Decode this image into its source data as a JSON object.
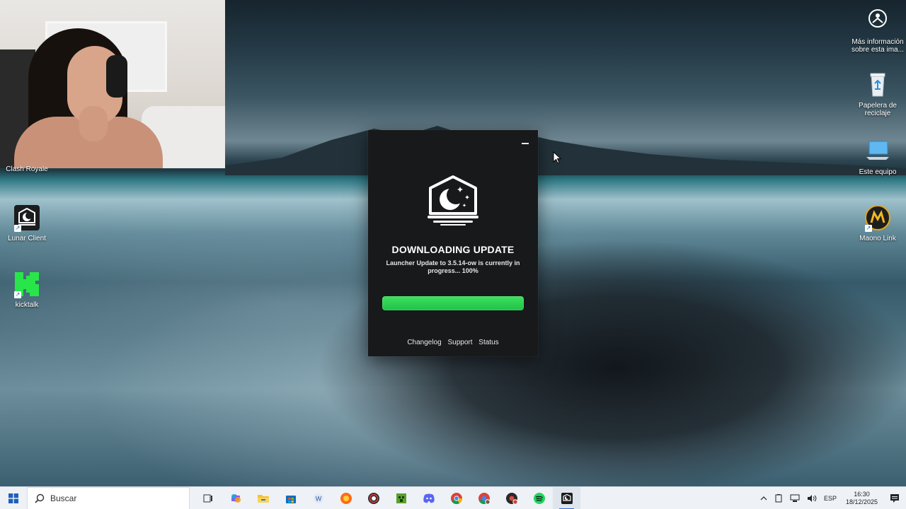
{
  "desktop": {
    "icons_left": [
      {
        "label": "Clash Royale",
        "icon": "clash-royale-icon"
      },
      {
        "label": "Lunar Client",
        "icon": "lunar-client-icon"
      },
      {
        "label": "kicktalk",
        "icon": "kicktalk-icon"
      }
    ],
    "icons_right": [
      {
        "label": "Más información sobre esta ima...",
        "icon": "info-camera-icon"
      },
      {
        "label": "Papelera de reciclaje",
        "icon": "recycle-bin-icon"
      },
      {
        "label": "Este equipo",
        "icon": "this-pc-icon"
      },
      {
        "label": "Maono Link",
        "icon": "maono-link-icon"
      }
    ]
  },
  "launcher": {
    "title": "DOWNLOADING UPDATE",
    "subtitle": "Launcher Update to 3.5.14-ow is currently in progress... 100%",
    "progress": 1.0,
    "links": [
      "Changelog",
      "Support",
      "Status"
    ],
    "accent": "#22c84c",
    "logo_icon": "lunar-moon-house-icon",
    "minimize_icon": "minimize-icon"
  },
  "taskbar": {
    "search_placeholder": "Buscar",
    "apps": [
      {
        "name": "task-view-icon"
      },
      {
        "name": "copilot-icon"
      },
      {
        "name": "file-explorer-icon"
      },
      {
        "name": "microsoft-store-icon"
      },
      {
        "name": "word-icon"
      },
      {
        "name": "brave-icon"
      },
      {
        "name": "obs-icon"
      },
      {
        "name": "minecraft-icon"
      },
      {
        "name": "discord-icon"
      },
      {
        "name": "chrome-icon"
      },
      {
        "name": "chrome-profile-icon"
      },
      {
        "name": "chrome-profile-2-icon"
      },
      {
        "name": "spotify-icon"
      },
      {
        "name": "lunar-client-icon",
        "active": true
      }
    ],
    "tray": {
      "language": "ESP",
      "time": "16:30",
      "date": "18/12/2025"
    }
  }
}
